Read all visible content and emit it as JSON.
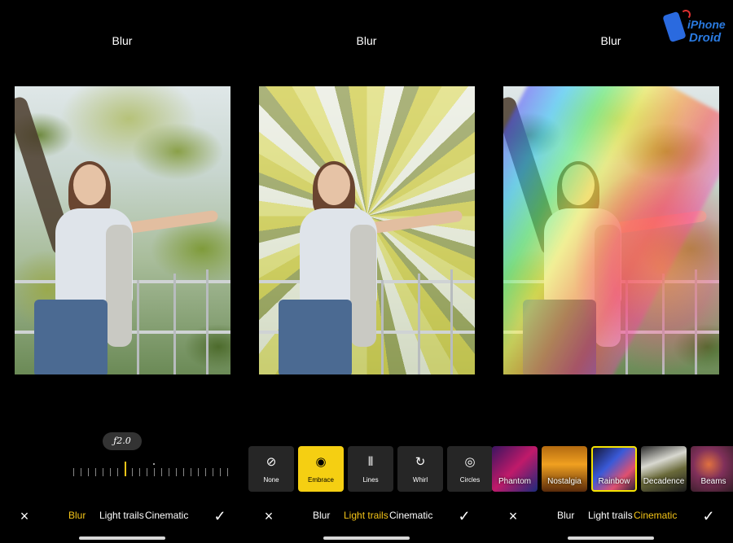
{
  "panels": [
    {
      "title": "Blur",
      "photo_variant": "original",
      "aperture": "ƒ2.0",
      "tabs": [
        "Blur",
        "Light trails",
        "Cinematic"
      ],
      "active_tab": 0
    },
    {
      "title": "Blur",
      "photo_variant": "embrace",
      "effects": [
        {
          "label": "None",
          "icon": "none-icon",
          "glyph": "⊘"
        },
        {
          "label": "Embrace",
          "icon": "embrace-icon",
          "glyph": "◉",
          "selected": true
        },
        {
          "label": "Lines",
          "icon": "lines-icon",
          "glyph": "⦀"
        },
        {
          "label": "Whirl",
          "icon": "whirl-icon",
          "glyph": "↻"
        },
        {
          "label": "Circles",
          "icon": "circles-icon",
          "glyph": "◎"
        }
      ],
      "tabs": [
        "Blur",
        "Light trails",
        "Cinematic"
      ],
      "active_tab": 1
    },
    {
      "title": "Blur",
      "photo_variant": "rainbow",
      "light_options": [
        {
          "label": "Phantom"
        },
        {
          "label": "Nostalgia"
        },
        {
          "label": "Rainbow",
          "selected": true
        },
        {
          "label": "Decadence"
        },
        {
          "label": "Beams"
        }
      ],
      "tabs": [
        "Blur",
        "Light trails",
        "Cinematic"
      ],
      "active_tab": 2
    }
  ],
  "icons": {
    "close": "×",
    "confirm": "✓"
  },
  "watermark": {
    "line1": "iPhone",
    "line2": "Droid"
  },
  "colors": {
    "accent": "#f5c518",
    "selected_effect": "#f5cf12",
    "background": "#000000"
  }
}
